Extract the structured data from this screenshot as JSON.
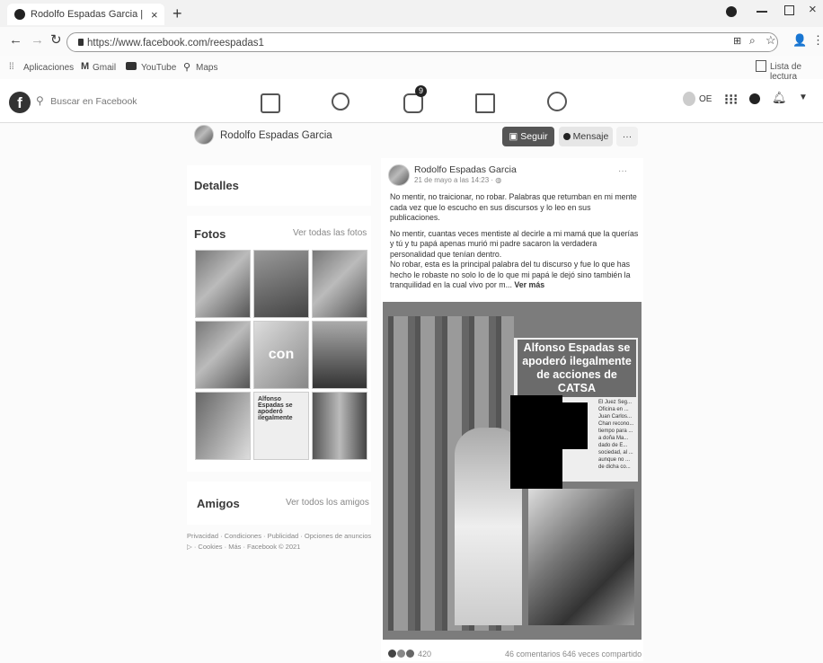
{
  "browser": {
    "tab_title": "Rodolfo Espadas Garcia | Faceb...",
    "tab_close": "×",
    "new_tab": "+",
    "url": "https://www.facebook.com/reespadas1",
    "bookmarks": [
      "Aplicaciones",
      "Gmail",
      "YouTube",
      "Maps"
    ],
    "reading_list": "Lista de lectura"
  },
  "fb_nav": {
    "search_placeholder": "Buscar en Facebook",
    "user_initials": "OE",
    "notification_count": "9"
  },
  "profile_header": {
    "name": "Rodolfo Espadas Garcia",
    "follow_label": "Seguir",
    "message_label": "Mensaje",
    "more_label": "···"
  },
  "left_column": {
    "details_title": "Detalles",
    "photos_title": "Fotos",
    "see_all_photos": "Ver todas las fotos",
    "friends_title": "Amigos",
    "see_all_friends": "Ver todos los amigos",
    "footer_line1": "Privacidad · Condiciones · Publicidad · Opciones de anuncios",
    "footer_line2": "▷ · Cookies · Más · Facebook © 2021",
    "photo_captions": [
      "",
      "",
      "",
      "",
      "con",
      "",
      "Alfonso Espadas se apoderó ilegalmente",
      "",
      ""
    ]
  },
  "post": {
    "author": "Rodolfo Espadas Garcia",
    "timestamp": "21 de mayo a las 14:23 · ",
    "menu": "···",
    "text_p1": "No mentir, no traicionar, no robar. Palabras que retumban en mi mente cada vez que lo escucho en sus discursos y lo leo en sus publicaciones.",
    "text_p2": "No mentir, cuantas veces mentiste al decirle a mi mamá que la querías y tú y tu papá apenas murió mi padre sacaron la verdadera personalidad que tenían dentro.",
    "text_p3": "No robar, esta es la principal palabra del tu discurso y fue lo que has hecho le robaste no solo lo de lo que mi papá le dejó sino también la tranquilidad en la cual vivo por m... ",
    "see_more": "Ver más",
    "headline": "Alfonso Espadas se apoderó ilegalmente de acciones de CATSA",
    "side_text": "El Juez Seg... Oficina en ... Juan Carlos... Chan recono... tiempo para ... a doña Ma... dado de E... sociedad, al ... aunque no ... de dicha co...",
    "reactions_count": "420",
    "stats": "46 comentarios  646 veces compartido"
  }
}
